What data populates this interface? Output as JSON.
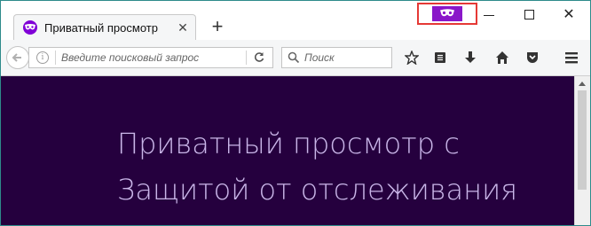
{
  "tab": {
    "title": "Приватный просмотр",
    "close_symbol": "✕"
  },
  "new_tab_symbol": "+",
  "window_controls": {
    "close_symbol": "✕"
  },
  "navbar": {
    "url_placeholder": "Введите поисковый запрос",
    "search_placeholder": "Поиск"
  },
  "page": {
    "headline_line1": "Приватный просмотр с",
    "headline_line2": "Защитой от отслеживания"
  },
  "colors": {
    "private_purple": "#8a17c9",
    "content_bg": "#25003e",
    "headline_text": "#c9b6e8",
    "highlight_box": "#e53935"
  },
  "icons": [
    "private-mask-icon",
    "back-arrow-icon",
    "info-icon",
    "reload-icon",
    "search-icon",
    "bookmark-star-icon",
    "reading-list-icon",
    "download-icon",
    "home-icon",
    "pocket-icon",
    "menu-icon"
  ]
}
